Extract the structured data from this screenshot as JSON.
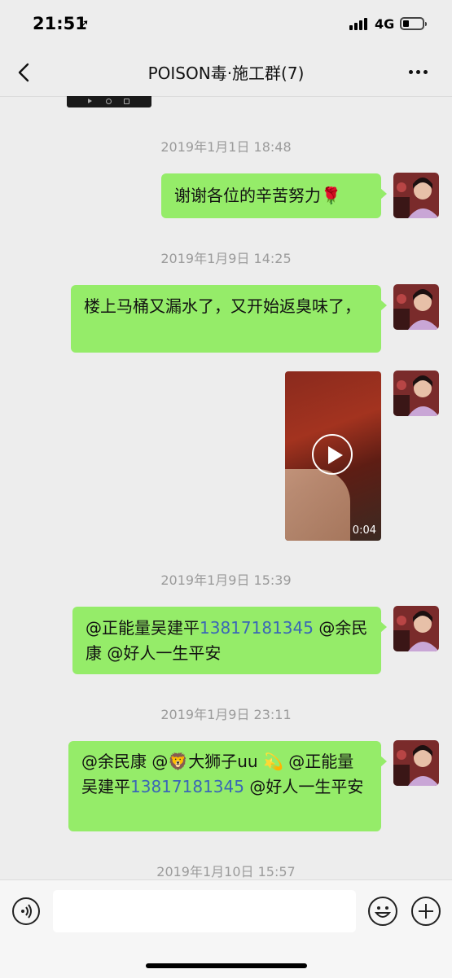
{
  "status": {
    "time": "21:51",
    "network": "4G"
  },
  "header": {
    "title": "POISON毒·施工群(7)"
  },
  "chat": {
    "ts1": "2019年1月1日 18:48",
    "msg1": "谢谢各位的辛苦努力🌹",
    "ts2": "2019年1月9日 14:25",
    "msg2": "楼上马桶又漏水了，又开始返臭味了，",
    "video_duration": "0:04",
    "ts3": "2019年1月9日 15:39",
    "msg4_a": "@正能量吴建平",
    "msg4_phone": "13817181345",
    "msg4_b": " @余民康 @好人一生平安",
    "ts4": "2019年1月9日 23:11",
    "msg5_a": "@余民康 @🦁大狮子uu 💫 @正能量吴建平",
    "msg5_phone": "13817181345",
    "msg5_b": " @好人一生平安",
    "ts5": "2019年1月10日 15:57"
  },
  "colors": {
    "bubble": "#95ec69",
    "link": "#3a67b6",
    "background": "#ededed"
  }
}
